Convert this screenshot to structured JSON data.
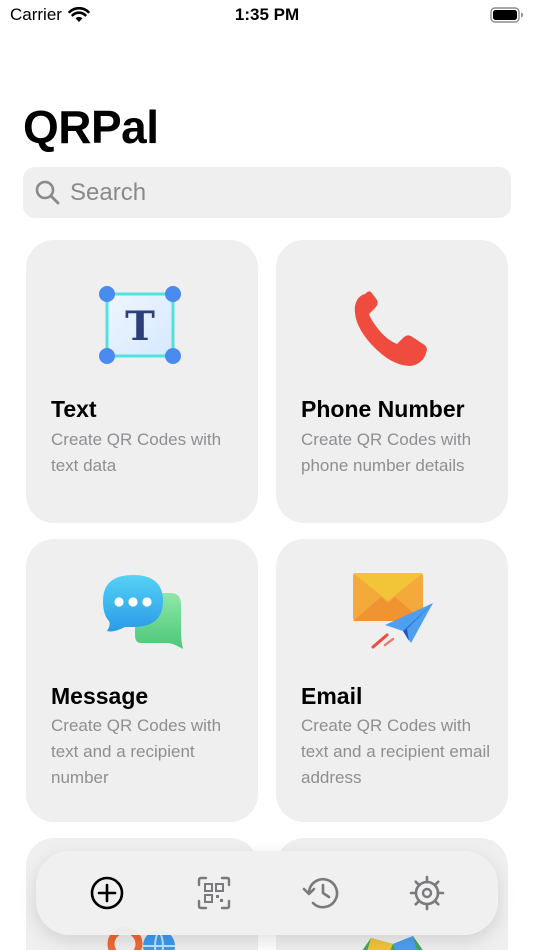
{
  "status_bar": {
    "carrier": "Carrier",
    "time": "1:35 PM"
  },
  "app": {
    "title": "QRPal"
  },
  "search": {
    "placeholder": "Search",
    "value": ""
  },
  "cards": [
    {
      "id": "text",
      "title": "Text",
      "description": "Create QR Codes with text data",
      "icon": "text-box-icon"
    },
    {
      "id": "phone",
      "title": "Phone Number",
      "description": "Create QR Codes with phone number details",
      "icon": "phone-icon"
    },
    {
      "id": "message",
      "title": "Message",
      "description": "Create QR Codes with text and a recipient number",
      "icon": "chat-bubbles-icon"
    },
    {
      "id": "email",
      "title": "Email",
      "description": "Create QR Codes with text and a recipient email address",
      "icon": "envelope-plane-icon"
    }
  ],
  "tab_bar": {
    "items": [
      {
        "icon": "plus-circle-icon",
        "selected": true
      },
      {
        "icon": "qr-scan-icon",
        "selected": false
      },
      {
        "icon": "history-icon",
        "selected": false
      },
      {
        "icon": "gear-icon",
        "selected": false
      }
    ]
  },
  "colors": {
    "card_bg": "#efeff0",
    "desc_text": "#8e8e93",
    "tab_icon": "#7a7a7e",
    "tab_icon_selected": "#000000"
  }
}
